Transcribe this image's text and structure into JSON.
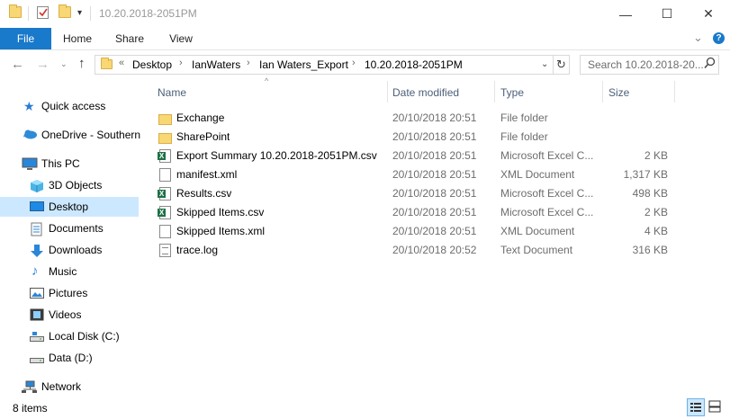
{
  "window": {
    "title": "10.20.2018-2051PM",
    "minimize_icon": "—",
    "maximize_icon": "☐",
    "close_icon": "✕"
  },
  "ribbon": {
    "tabs": [
      "File",
      "Home",
      "Share",
      "View"
    ],
    "expand_icon": "⌄",
    "help_icon": "?"
  },
  "address": {
    "overflow": "«",
    "crumbs": [
      "Desktop",
      "IanWaters",
      "Ian Waters_Export",
      "10.20.2018-2051PM"
    ],
    "search_placeholder": "Search 10.20.2018-20..."
  },
  "nav": {
    "items": [
      {
        "label": "Quick access",
        "icon": "star-icon"
      },
      {
        "label": "OneDrive - Southern",
        "icon": "cloud-icon"
      },
      {
        "label": "This PC",
        "icon": "computer-icon"
      },
      {
        "label": "3D Objects",
        "icon": "cube-icon"
      },
      {
        "label": "Desktop",
        "icon": "desktop-icon"
      },
      {
        "label": "Documents",
        "icon": "documents-icon"
      },
      {
        "label": "Downloads",
        "icon": "download-icon"
      },
      {
        "label": "Music",
        "icon": "music-icon"
      },
      {
        "label": "Pictures",
        "icon": "pictures-icon"
      },
      {
        "label": "Videos",
        "icon": "video-icon"
      },
      {
        "label": "Local Disk (C:)",
        "icon": "drive-icon"
      },
      {
        "label": "Data (D:)",
        "icon": "drive-icon"
      },
      {
        "label": "Network",
        "icon": "network-icon"
      }
    ]
  },
  "list": {
    "columns": [
      "Name",
      "Date modified",
      "Type",
      "Size"
    ],
    "rows": [
      {
        "name": "Exchange",
        "date": "20/10/2018 20:51",
        "type": "File folder",
        "size": "",
        "icon": "folder-icon"
      },
      {
        "name": "SharePoint",
        "date": "20/10/2018 20:51",
        "type": "File folder",
        "size": "",
        "icon": "folder-icon"
      },
      {
        "name": "Export Summary 10.20.2018-2051PM.csv",
        "date": "20/10/2018 20:51",
        "type": "Microsoft Excel C...",
        "size": "2 KB",
        "icon": "excel-icon"
      },
      {
        "name": "manifest.xml",
        "date": "20/10/2018 20:51",
        "type": "XML Document",
        "size": "1,317 KB",
        "icon": "document-icon"
      },
      {
        "name": "Results.csv",
        "date": "20/10/2018 20:51",
        "type": "Microsoft Excel C...",
        "size": "498 KB",
        "icon": "excel-icon"
      },
      {
        "name": "Skipped Items.csv",
        "date": "20/10/2018 20:51",
        "type": "Microsoft Excel C...",
        "size": "2 KB",
        "icon": "excel-icon"
      },
      {
        "name": "Skipped Items.xml",
        "date": "20/10/2018 20:51",
        "type": "XML Document",
        "size": "4 KB",
        "icon": "document-icon"
      },
      {
        "name": "trace.log",
        "date": "20/10/2018 20:52",
        "type": "Text Document",
        "size": "316 KB",
        "icon": "text-file-icon"
      }
    ]
  },
  "status": {
    "item_count": "8 items"
  },
  "colors": {
    "accent": "#1979ca",
    "selected": "#cce8ff",
    "folder": "#f8d775"
  }
}
